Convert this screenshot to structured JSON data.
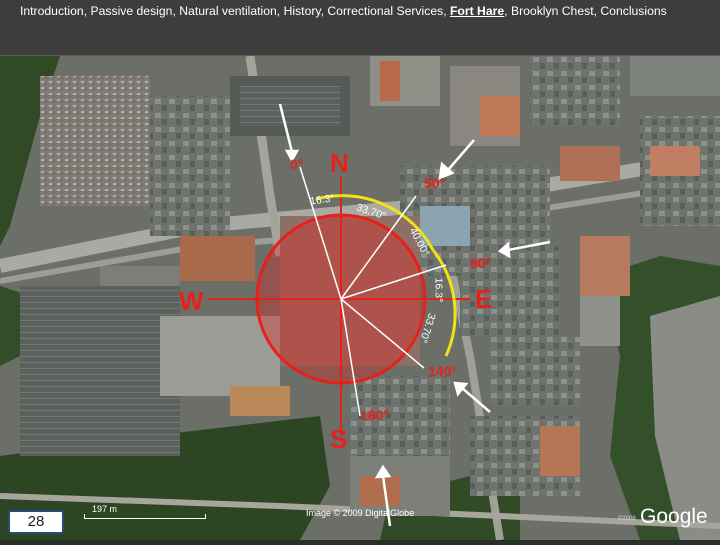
{
  "nav": {
    "items": [
      "Introduction",
      "Passive design",
      "Natural ventilation",
      "History",
      "Correctional Services"
    ],
    "active": "Fort Hare",
    "after": [
      "Brooklyn Chest",
      "Conclusions"
    ],
    "separator": ", "
  },
  "compass": {
    "north": "N",
    "south": "S",
    "east": "E",
    "west": "W"
  },
  "bearings": {
    "b0": "0°",
    "b50": "50°",
    "b90": "90°",
    "b140": "140°",
    "b180": "180°"
  },
  "sector_angles": {
    "a1": "16.3°",
    "a2": "33.70°",
    "a3": "40.00°",
    "a4": "16.3°",
    "a5": "33.70°"
  },
  "footer": {
    "page_number": "28",
    "scale": "197 m",
    "copyright": "Image © 2009 DigitalGlobe",
    "logo": "Google",
    "small_copy": "©2008"
  },
  "colors": {
    "compass_red": "#e8201c",
    "sector_yellow": "#f2e21a",
    "arrow_white": "#ffffff"
  }
}
